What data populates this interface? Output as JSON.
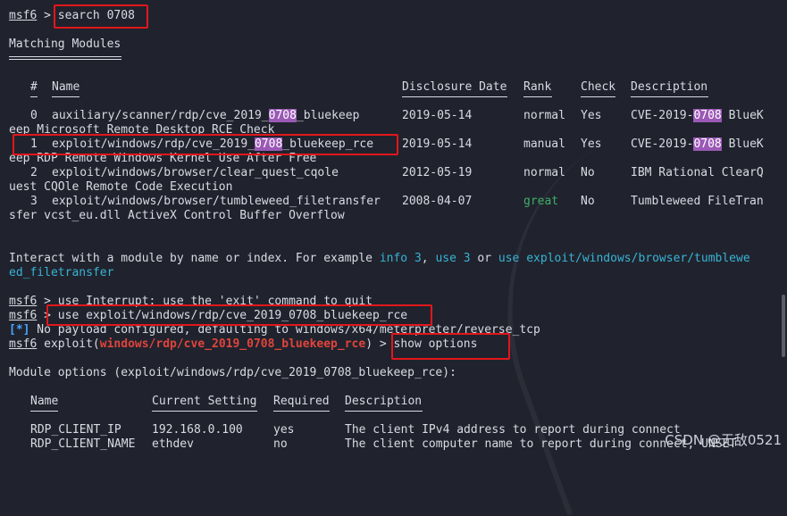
{
  "prompt": "msf6",
  "prompt_sep": " > ",
  "cmd_search": "search 0708",
  "matching_title": "Matching Modules",
  "headers": {
    "num": "#",
    "name": "Name",
    "date": "Disclosure Date",
    "rank": "Rank",
    "check": "Check",
    "desc": "Description"
  },
  "rows": [
    {
      "num": "0",
      "name_a": "auxiliary/scanner/rdp/cve_2019_",
      "name_hl": "0708",
      "name_b": "_bluekeep",
      "date": "2019-05-14",
      "rank": "normal",
      "check": "Yes",
      "desc_a": "CVE-2019-",
      "desc_hl": "0708",
      "desc_b": " BlueK",
      "wrap": "eep Microsoft Remote Desktop RCE Check"
    },
    {
      "num": "1",
      "name_a": "exploit/windows/rdp/cve_2019_",
      "name_hl": "0708",
      "name_b": "_bluekeep_rce",
      "date": "2019-05-14",
      "rank": "manual",
      "check": "Yes",
      "desc_a": "CVE-2019-",
      "desc_hl": "0708",
      "desc_b": " BlueK",
      "wrap": "eep RDP Remote Windows Kernel Use After Free"
    },
    {
      "num": "2",
      "name_a": "exploit/windows/browser/clear_quest_cqole",
      "date": "2012-05-19",
      "rank": "normal",
      "check": "No",
      "desc_a": "IBM Rational ClearQ",
      "wrap": "uest CQOle Remote Code Execution"
    },
    {
      "num": "3",
      "name_a": "exploit/windows/browser/tumbleweed_filetransfer",
      "date": "2008-04-07",
      "rank": "great",
      "check": "No",
      "desc_a": "Tumbleweed FileTran",
      "wrap": "sfer vcst_eu.dll ActiveX Control Buffer Overflow"
    }
  ],
  "interact": {
    "a": "Interact with a module by name or index. For example ",
    "info": "info 3",
    "comma": ", ",
    "use3": "use 3",
    "or": " or ",
    "use_full": "use exploit/windows/browser/tumblewe",
    "wrap": "ed_filetransfer"
  },
  "interrupt_line": " > use Interrupt: use the 'exit' command to quit",
  "cmd_use": "use exploit/windows/rdp/cve_2019_0708_bluekeep_rce",
  "star": "[*]",
  "payload_msg": " No payload configured, defaulting to windows/x64/meterpreter/reverse_tcp",
  "exploit_word": "exploit(",
  "exploit_module": "windows/rdp/cve_2019_0708_bluekeep_rce",
  "exploit_close": ") > ",
  "cmd_show": "show options",
  "module_options": "Module options (exploit/windows/rdp/cve_2019_0708_bluekeep_rce):",
  "opt_headers": {
    "name": "Name",
    "setting": "Current Setting",
    "required": "Required",
    "desc": "Description"
  },
  "options": [
    {
      "name": "RDP_CLIENT_IP",
      "setting": "192.168.0.100",
      "required": "yes",
      "desc": "The client IPv4 address to report during connect"
    },
    {
      "name": "RDP_CLIENT_NAME",
      "setting": "ethdev",
      "required": "no",
      "desc": "The client computer name to report during connect, UNSET"
    }
  ],
  "watermark": "CSDN @无敌0521",
  "colors": {
    "bg": "#20232d",
    "highlight": "#9b59b6",
    "red_box": "#e3161b",
    "module_red": "#e0443c",
    "link_cyan": "#39b3d6",
    "rank_green": "#3fae6a",
    "star_blue": "#4aa3ff"
  }
}
